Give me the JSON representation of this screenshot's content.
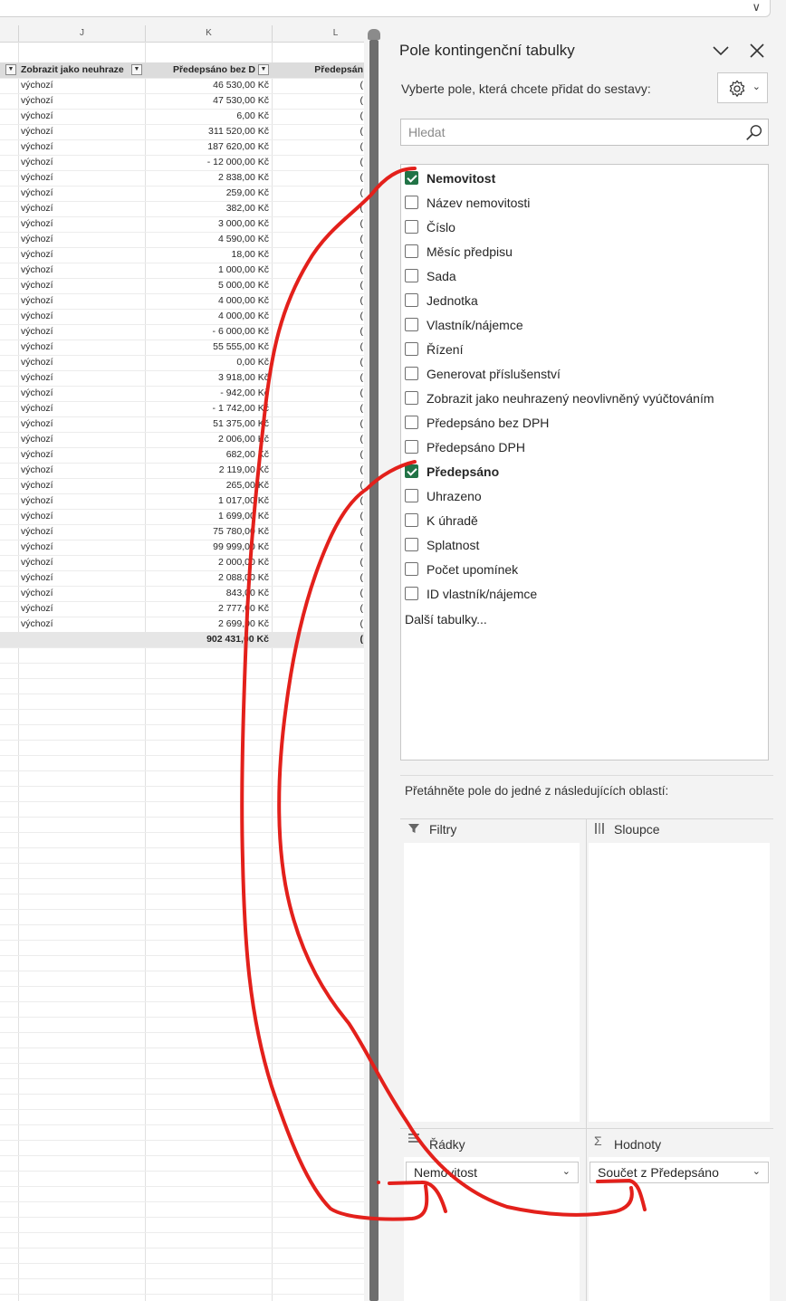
{
  "formula_bar": {
    "chevron": "∨"
  },
  "sheet": {
    "columns": [
      "J",
      "K",
      "L"
    ],
    "header_row": {
      "j": "Zobrazit jako neuhraze",
      "k": "Předepsáno bez D",
      "l": "Předepsán"
    },
    "rows": [
      {
        "j": "výchozí",
        "k": "46 530,00 Kč",
        "l": "("
      },
      {
        "j": "výchozí",
        "k": "47 530,00 Kč",
        "l": "("
      },
      {
        "j": "výchozí",
        "k": "6,00 Kč",
        "l": "("
      },
      {
        "j": "výchozí",
        "k": "311 520,00 Kč",
        "l": "("
      },
      {
        "j": "výchozí",
        "k": "187 620,00 Kč",
        "l": "("
      },
      {
        "j": "výchozí",
        "k": "- 12 000,00 Kč",
        "l": "("
      },
      {
        "j": "výchozí",
        "k": "2 838,00 Kč",
        "l": "("
      },
      {
        "j": "výchozí",
        "k": "259,00 Kč",
        "l": "("
      },
      {
        "j": "výchozí",
        "k": "382,00 Kč",
        "l": "("
      },
      {
        "j": "výchozí",
        "k": "3 000,00 Kč",
        "l": "("
      },
      {
        "j": "výchozí",
        "k": "4 590,00 Kč",
        "l": "("
      },
      {
        "j": "výchozí",
        "k": "18,00 Kč",
        "l": "("
      },
      {
        "j": "výchozí",
        "k": "1 000,00 Kč",
        "l": "("
      },
      {
        "j": "výchozí",
        "k": "5 000,00 Kč",
        "l": "("
      },
      {
        "j": "výchozí",
        "k": "4 000,00 Kč",
        "l": "("
      },
      {
        "j": "výchozí",
        "k": "4 000,00 Kč",
        "l": "("
      },
      {
        "j": "výchozí",
        "k": "- 6 000,00 Kč",
        "l": "("
      },
      {
        "j": "výchozí",
        "k": "55 555,00 Kč",
        "l": "("
      },
      {
        "j": "výchozí",
        "k": "0,00 Kč",
        "l": "("
      },
      {
        "j": "výchozí",
        "k": "3 918,00 Kč",
        "l": "("
      },
      {
        "j": "výchozí",
        "k": "-  942,00 Kč",
        "l": "("
      },
      {
        "j": "výchozí",
        "k": "- 1 742,00 Kč",
        "l": "("
      },
      {
        "j": "výchozí",
        "k": "51 375,00 Kč",
        "l": "("
      },
      {
        "j": "výchozí",
        "k": "2 006,00 Kč",
        "l": "("
      },
      {
        "j": "výchozí",
        "k": "682,00 Kč",
        "l": "("
      },
      {
        "j": "výchozí",
        "k": "2 119,00 Kč",
        "l": "("
      },
      {
        "j": "výchozí",
        "k": "265,00 Kč",
        "l": "("
      },
      {
        "j": "výchozí",
        "k": "1 017,00 Kč",
        "l": "("
      },
      {
        "j": "výchozí",
        "k": "1 699,00 Kč",
        "l": "("
      },
      {
        "j": "výchozí",
        "k": "75 780,00 Kč",
        "l": "("
      },
      {
        "j": "výchozí",
        "k": "99 999,00 Kč",
        "l": "("
      },
      {
        "j": "výchozí",
        "k": "2 000,00 Kč",
        "l": "("
      },
      {
        "j": "výchozí",
        "k": "2 088,00 Kč",
        "l": "("
      },
      {
        "j": "výchozí",
        "k": "843,00 Kč",
        "l": "("
      },
      {
        "j": "výchozí",
        "k": "2 777,00 Kč",
        "l": "("
      },
      {
        "j": "výchozí",
        "k": "2 699,00 Kč",
        "l": "("
      }
    ],
    "total": {
      "k": "902 431,00 Kč",
      "l": "("
    }
  },
  "pane": {
    "title": "Pole kontingenční tabulky",
    "subtitle": "Vyberte pole, která chcete přidat do sestavy:",
    "search_placeholder": "Hledat",
    "fields": [
      {
        "label": "Nemovitost",
        "checked": true
      },
      {
        "label": "Název nemovitosti",
        "checked": false
      },
      {
        "label": "Číslo",
        "checked": false
      },
      {
        "label": "Měsíc předpisu",
        "checked": false
      },
      {
        "label": "Sada",
        "checked": false
      },
      {
        "label": "Jednotka",
        "checked": false
      },
      {
        "label": "Vlastník/nájemce",
        "checked": false
      },
      {
        "label": "Řízení",
        "checked": false
      },
      {
        "label": "Generovat příslušenství",
        "checked": false
      },
      {
        "label": "Zobrazit jako neuhrazený neovlivněný vyúčtováním",
        "checked": false
      },
      {
        "label": "Předepsáno bez DPH",
        "checked": false
      },
      {
        "label": "Předepsáno DPH",
        "checked": false
      },
      {
        "label": "Předepsáno",
        "checked": true
      },
      {
        "label": "Uhrazeno",
        "checked": false
      },
      {
        "label": "K úhradě",
        "checked": false
      },
      {
        "label": "Splatnost",
        "checked": false
      },
      {
        "label": "Počet upomínek",
        "checked": false
      },
      {
        "label": "ID vlastník/nájemce",
        "checked": false
      }
    ],
    "more_tables": "Další tabulky...",
    "drag_label": "Přetáhněte pole do jedné z následujících oblastí:",
    "areas": {
      "filters": "Filtry",
      "columns": "Sloupce",
      "rows": "Řádky",
      "values": "Hodnoty",
      "rows_item": "Nemovitost",
      "values_item": "Součet z Předepsáno"
    },
    "icons": [
      "chevron-down-icon",
      "close-icon",
      "gear-icon",
      "search-icon",
      "filter-icon",
      "columns-icon",
      "rows-icon",
      "sigma-icon"
    ]
  },
  "colors": {
    "checkbox_on": "#217346",
    "annotation": "#e3201b"
  }
}
